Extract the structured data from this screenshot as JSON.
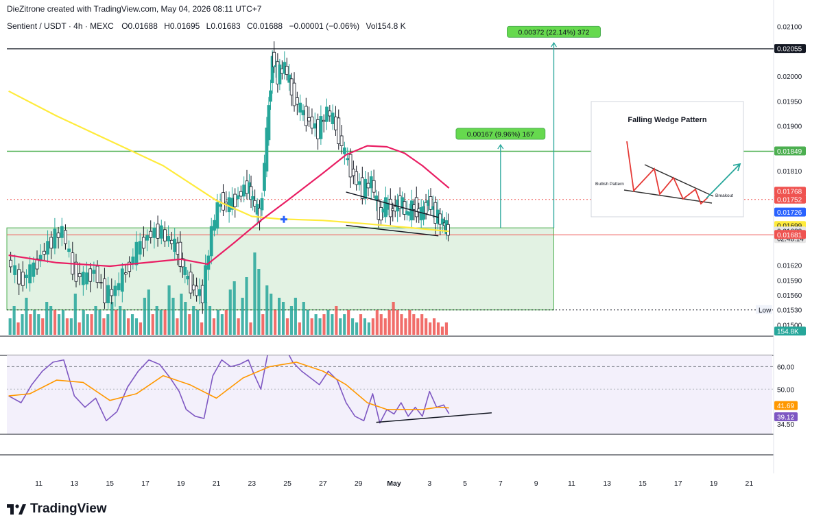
{
  "header": {
    "credit": "DieZitrone created with TradingView.com, May 04, 2026 08:11 UTC+7"
  },
  "legend": {
    "symbol": "Sentient / USDT · 4h · MEXC",
    "open": "O0.01688",
    "high": "H0.01695",
    "low": "L0.01683",
    "close": "C0.01688",
    "change": "−0.00001 (−0.06%)",
    "volume": "Vol154.8 K"
  },
  "colors": {
    "up": "#26a69a",
    "down": "#ef5350",
    "ema_fast": "#e91e63",
    "ema_slow": "#ffeb3b",
    "rsi": "#7e57c2",
    "rsi_ma": "#ff9800",
    "target_green": "#4caf50",
    "accent_blue": "#2962ff"
  },
  "chart_data": [
    {
      "type": "candlestick",
      "symbol": "Sentient / USDT",
      "timeframe": "4h",
      "exchange": "MEXC",
      "y_axis": {
        "range": [
          0.0148,
          0.0212
        ],
        "tick_labels": [
          "0.02100",
          "0.02000",
          "0.01950",
          "0.01900",
          "0.01810",
          "0.01620",
          "0.01590",
          "0.01560",
          "0.01500"
        ]
      },
      "x_axis": {
        "tick_labels": [
          "11",
          "13",
          "15",
          "17",
          "19",
          "21",
          "23",
          "25",
          "27",
          "29",
          "May",
          "3",
          "5",
          "7",
          "9",
          "11",
          "13",
          "15",
          "17",
          "19",
          "21"
        ],
        "tick_days": [
          11,
          13,
          15,
          17,
          19,
          21,
          23,
          25,
          27,
          29,
          31,
          33,
          35,
          37,
          39,
          41,
          43,
          45,
          47,
          49,
          51
        ],
        "day_range": [
          9.2,
          52.3
        ]
      },
      "close_path": [
        [
          9.3,
          0.0163
        ],
        [
          10.0,
          0.0159
        ],
        [
          10.6,
          0.01605
        ],
        [
          11.2,
          0.0164
        ],
        [
          11.8,
          0.0167
        ],
        [
          12.4,
          0.0169
        ],
        [
          13.0,
          0.0161
        ],
        [
          13.6,
          0.0159
        ],
        [
          14.2,
          0.0161
        ],
        [
          14.8,
          0.0156
        ],
        [
          15.4,
          0.0157
        ],
        [
          16.0,
          0.0161
        ],
        [
          16.6,
          0.0165
        ],
        [
          17.2,
          0.0168
        ],
        [
          17.8,
          0.0169
        ],
        [
          18.4,
          0.0167
        ],
        [
          18.9,
          0.0165
        ],
        [
          19.3,
          0.016
        ],
        [
          19.8,
          0.0157
        ],
        [
          20.3,
          0.0156
        ],
        [
          20.8,
          0.0169
        ],
        [
          21.3,
          0.0175
        ],
        [
          21.8,
          0.0174
        ],
        [
          22.3,
          0.0176
        ],
        [
          22.8,
          0.0178
        ],
        [
          23.1,
          0.0175
        ],
        [
          23.5,
          0.01715
        ],
        [
          23.9,
          0.0188
        ],
        [
          24.2,
          0.0204
        ],
        [
          24.5,
          0.02
        ],
        [
          24.9,
          0.0202
        ],
        [
          25.3,
          0.0197
        ],
        [
          25.8,
          0.0193
        ],
        [
          26.3,
          0.0191
        ],
        [
          26.8,
          0.0189
        ],
        [
          27.3,
          0.0193
        ],
        [
          27.8,
          0.019
        ],
        [
          28.3,
          0.0184
        ],
        [
          28.8,
          0.018
        ],
        [
          29.3,
          0.0177
        ],
        [
          29.8,
          0.0179
        ],
        [
          30.2,
          0.0172
        ],
        [
          30.6,
          0.0174
        ],
        [
          31.0,
          0.0173
        ],
        [
          31.4,
          0.0175
        ],
        [
          31.8,
          0.0172
        ],
        [
          32.2,
          0.0174
        ],
        [
          32.6,
          0.0172
        ],
        [
          33.0,
          0.0175
        ],
        [
          33.4,
          0.0172
        ],
        [
          33.8,
          0.01705
        ],
        [
          34.1,
          0.01688
        ]
      ],
      "ema_fast": [
        [
          9.3,
          0.0164
        ],
        [
          12.0,
          0.01625
        ],
        [
          15.0,
          0.01618
        ],
        [
          17.0,
          0.01625
        ],
        [
          19.0,
          0.01632
        ],
        [
          20.5,
          0.01622
        ],
        [
          22.0,
          0.01665
        ],
        [
          23.5,
          0.0171
        ],
        [
          25.0,
          0.0175
        ],
        [
          27.0,
          0.01805
        ],
        [
          28.3,
          0.01842
        ],
        [
          29.5,
          0.0186
        ],
        [
          30.6,
          0.01858
        ],
        [
          31.6,
          0.01845
        ],
        [
          32.6,
          0.0182
        ],
        [
          33.6,
          0.0179
        ],
        [
          34.1,
          0.01775
        ]
      ],
      "ema_slow": [
        [
          9.3,
          0.0197
        ],
        [
          12.0,
          0.0192
        ],
        [
          15.0,
          0.0187
        ],
        [
          18.0,
          0.0182
        ],
        [
          21.0,
          0.0175
        ],
        [
          23.0,
          0.01718
        ],
        [
          24.5,
          0.01713
        ],
        [
          27.0,
          0.0171
        ],
        [
          29.5,
          0.01703
        ],
        [
          32.0,
          0.01695
        ],
        [
          34.1,
          0.01688
        ]
      ],
      "volume": {
        "last": "154.8K",
        "up_levels": [
          0.2,
          0.35,
          0.25,
          0.45,
          0.3,
          0.25,
          0.4,
          0.35,
          0.25,
          0.3,
          0.2,
          0.5,
          0.3,
          0.25,
          0.35,
          0.3,
          0.25,
          0.4,
          0.35,
          0.3,
          0.25,
          0.2,
          0.45,
          0.55,
          0.35,
          0.3,
          0.6,
          0.45,
          0.5,
          0.4,
          0.35,
          0.3,
          0.4,
          0.35,
          0.3,
          0.25,
          0.55,
          0.65,
          0.45,
          0.7,
          1.0,
          0.8,
          0.6,
          0.5,
          0.45,
          0.4,
          0.35,
          0.45,
          0.4,
          0.3,
          0.25,
          0.2,
          0.3,
          0.25,
          0.2,
          0.25,
          0.2,
          0.15,
          0.2,
          0.15
        ],
        "down_levels": [
          0.15,
          0.25,
          0.2,
          0.3,
          0.2,
          0.15,
          0.25,
          0.2,
          0.3,
          0.2,
          0.15,
          0.25,
          0.3,
          0.2,
          0.25,
          0.15,
          0.2,
          0.3,
          0.2,
          0.15,
          0.25,
          0.3,
          0.2,
          0.15,
          0.2,
          0.25,
          0.35,
          0.3,
          0.25,
          0.2,
          0.3,
          0.25,
          0.2,
          0.3,
          0.4,
          0.3,
          0.25,
          0.2,
          0.3,
          0.25,
          0.2,
          0.25,
          0.2,
          0.15,
          0.2,
          0.15,
          0.1,
          0.15
        ]
      },
      "price_labels": [
        {
          "value": 0.02055,
          "text": "0.02055",
          "bg": "#131722",
          "fg": "#ffffff"
        },
        {
          "value": 0.01849,
          "text": "0.01849",
          "bg": "#4caf50",
          "fg": "#ffffff"
        },
        {
          "value": 0.01768,
          "text": "0.01768",
          "bg": "#ef5350",
          "fg": "#ffffff"
        },
        {
          "value": 0.01752,
          "text": "0.01752",
          "bg": "#ef5350",
          "fg": "#ffffff"
        },
        {
          "value": 0.01726,
          "text": "0.01726",
          "bg": "#2962ff",
          "fg": "#ffffff"
        },
        {
          "value": 0.01699,
          "text": "0.01699",
          "bg": "#ffeb3b",
          "fg": "#131722"
        },
        {
          "value": 0.01688,
          "text": "0.01688",
          "bg": "#e6e6e6",
          "fg": "#131722",
          "sub": "02:48:14"
        },
        {
          "value": 0.01681,
          "text": "0.01681",
          "bg": "#ef5350",
          "fg": "#ffffff"
        },
        {
          "value": 0.0153,
          "text": "0.01530",
          "bg": "#ffffff",
          "fg": "#131722",
          "tag": "Low"
        }
      ],
      "horizontal_lines": [
        {
          "value": 0.02055,
          "color": "#131722"
        },
        {
          "value": 0.01849,
          "color": "#4caf50"
        }
      ],
      "target_zone": {
        "x": [
          9.2,
          40.0
        ],
        "y": [
          0.0153,
          0.01695
        ]
      },
      "wedge": {
        "upper": [
          [
            28.3,
            0.01767
          ],
          [
            33.5,
            0.01716
          ]
        ],
        "lower": [
          [
            28.3,
            0.017
          ],
          [
            33.5,
            0.01679
          ]
        ]
      },
      "targets": [
        {
          "label": "0.00167 (9.96%) 167",
          "x": 37.0,
          "from": 0.01695,
          "to": 0.01862
        },
        {
          "label": "0.00372 (22.14%) 372",
          "x": 40.0,
          "from": 0.01695,
          "to": 0.02067
        }
      ],
      "cross_marker": {
        "x": 24.8,
        "y": 0.01712
      }
    },
    {
      "type": "line",
      "indicator": "RSI",
      "y_axis": {
        "range": [
          30,
          65
        ],
        "tick_labels": [
          "60.00",
          "50.00",
          "34.50"
        ]
      },
      "series": [
        {
          "values": [
            [
              9.3,
              47
            ],
            [
              10.0,
              44
            ],
            [
              10.6,
              52
            ],
            [
              11.2,
              58
            ],
            [
              11.8,
              62
            ],
            [
              12.4,
              63
            ],
            [
              13.0,
              47
            ],
            [
              13.6,
              42
            ],
            [
              14.2,
              46
            ],
            [
              14.8,
              36
            ],
            [
              15.4,
              40
            ],
            [
              16.0,
              51
            ],
            [
              16.6,
              58
            ],
            [
              17.2,
              63
            ],
            [
              17.8,
              61
            ],
            [
              18.4,
              55
            ],
            [
              18.9,
              49
            ],
            [
              19.3,
              41
            ],
            [
              19.8,
              38
            ],
            [
              20.3,
              37
            ],
            [
              20.8,
              56
            ],
            [
              21.3,
              63
            ],
            [
              21.8,
              60
            ],
            [
              22.3,
              61
            ],
            [
              22.8,
              63
            ],
            [
              23.1,
              57
            ],
            [
              23.5,
              50
            ],
            [
              23.9,
              66
            ],
            [
              24.2,
              72
            ],
            [
              24.5,
              67
            ],
            [
              24.9,
              68
            ],
            [
              25.3,
              62
            ],
            [
              25.8,
              58
            ],
            [
              26.3,
              55
            ],
            [
              26.8,
              52
            ],
            [
              27.3,
              58
            ],
            [
              27.8,
              54
            ],
            [
              28.3,
              44
            ],
            [
              28.8,
              38
            ],
            [
              29.3,
              36
            ],
            [
              29.8,
              48
            ],
            [
              30.2,
              35
            ],
            [
              30.6,
              41
            ],
            [
              31.0,
              39
            ],
            [
              31.4,
              44
            ],
            [
              31.8,
              38
            ],
            [
              32.2,
              42
            ],
            [
              32.6,
              38
            ],
            [
              33.0,
              49
            ],
            [
              33.4,
              42
            ],
            [
              33.8,
              43
            ],
            [
              34.1,
              39.12
            ]
          ]
        },
        {
          "values": [
            [
              9.3,
              47
            ],
            [
              10.5,
              48
            ],
            [
              12.0,
              54
            ],
            [
              13.5,
              53
            ],
            [
              15.0,
              45
            ],
            [
              16.5,
              48
            ],
            [
              18.0,
              56
            ],
            [
              19.5,
              52
            ],
            [
              21.0,
              46
            ],
            [
              22.5,
              55
            ],
            [
              24.0,
              60
            ],
            [
              25.5,
              62
            ],
            [
              27.0,
              58
            ],
            [
              28.3,
              52
            ],
            [
              29.5,
              44
            ],
            [
              30.6,
              41
            ],
            [
              31.6,
              41
            ],
            [
              32.6,
              41
            ],
            [
              33.5,
              42
            ],
            [
              34.1,
              41.69
            ]
          ]
        }
      ],
      "value_labels": [
        {
          "value": 41.69,
          "text": "41.69",
          "bg": "#ff9800"
        },
        {
          "value": 39.12,
          "text": "39.12",
          "bg": "#7e57c2"
        }
      ],
      "trendline": [
        [
          30.0,
          35.3
        ],
        [
          36.5,
          39.5
        ]
      ]
    }
  ],
  "inset": {
    "title": "Falling Wedge Pattern",
    "left_label": "Bullish Pattern",
    "right_label": "Breakout"
  },
  "footer": {
    "brand": "TradingView"
  }
}
